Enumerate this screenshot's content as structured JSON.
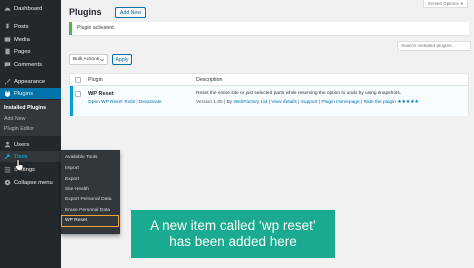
{
  "sidebar": {
    "items": [
      {
        "label": "Dashboard",
        "icon": "dashboard-icon"
      },
      {
        "label": "Posts",
        "icon": "pin-icon"
      },
      {
        "label": "Media",
        "icon": "media-icon"
      },
      {
        "label": "Pages",
        "icon": "page-icon"
      },
      {
        "label": "Comments",
        "icon": "comment-icon"
      },
      {
        "label": "Appearance",
        "icon": "paintbrush-icon"
      },
      {
        "label": "Plugins",
        "icon": "plug-icon"
      },
      {
        "label": "Users",
        "icon": "user-icon"
      },
      {
        "label": "Tools",
        "icon": "wrench-icon"
      },
      {
        "label": "Settings",
        "icon": "settings-icon"
      },
      {
        "label": "Collapse menu",
        "icon": "collapse-icon"
      }
    ],
    "plugins_submenu": [
      "Installed Plugins",
      "Add New",
      "Plugin Editor"
    ],
    "colors": {
      "bg": "#23282d",
      "active": "#0073aa",
      "highlight": "#00b9eb"
    }
  },
  "tools_flyout": {
    "items": [
      "Available Tools",
      "Import",
      "Export",
      "Site Health",
      "Export Personal Data",
      "Erase Personal Data"
    ],
    "highlighted": "WP Reset",
    "highlight_color": "#f2a33a"
  },
  "header": {
    "screen_options": "Screen Options",
    "title": "Plugins",
    "add_new": "Add New"
  },
  "notice": {
    "text": "Plugin activated.",
    "color": "#46b450"
  },
  "search": {
    "placeholder": "Search installed plugins..."
  },
  "bulk": {
    "selected": "Bulk Actions",
    "apply": "Apply"
  },
  "table": {
    "columns": [
      "Plugin",
      "Description"
    ],
    "rows": [
      {
        "name": "WP Reset",
        "actions": [
          "Open WP Reset Tools",
          "Deactivate"
        ],
        "description": "Reset the entire site or just selected parts while reserving the option to undo by using snapshots.",
        "version": "Version 1.80",
        "author_prefix": "By",
        "author": "WebFactory Ltd",
        "links": [
          "View details",
          "Support",
          "Plugin Homepage",
          "Rate the plugin"
        ],
        "stars": "★★★★★"
      }
    ]
  },
  "caption": {
    "line1": "A new item called ‘wp reset’",
    "line2": "has been added here",
    "color": "#1aaa8f"
  }
}
